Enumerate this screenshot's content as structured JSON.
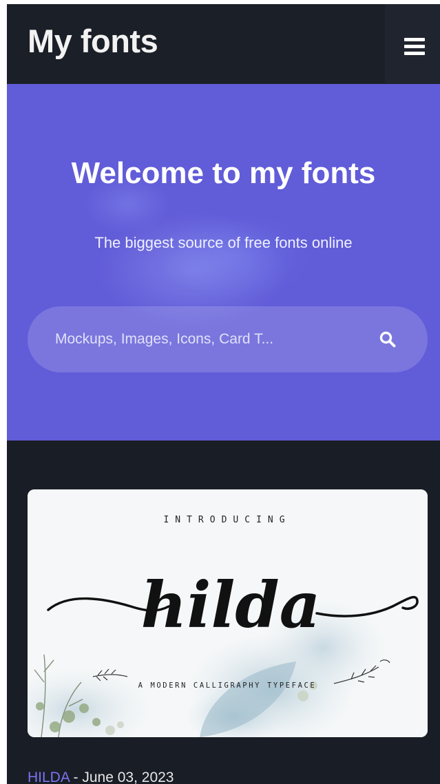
{
  "header": {
    "brand": "My fonts",
    "menu_icon": "hamburger-menu-icon"
  },
  "hero": {
    "title": "Welcome to my fonts",
    "subtitle": "The biggest source of free fonts online",
    "search": {
      "placeholder": "Mockups, Images, Icons, Card T...",
      "value": "",
      "icon": "search-icon"
    }
  },
  "card": {
    "image": {
      "intro": "INTRODUCING",
      "name": "hilda",
      "tagline": "A MODERN CALLIGRAPHY TYPEFACE"
    },
    "link_label": "HILDA",
    "separator": " - ",
    "date": "June 03, 2023"
  },
  "colors": {
    "background": "#191d26",
    "header": "#1b1f28",
    "hero": "#615cd8",
    "link": "#7b74f0"
  }
}
